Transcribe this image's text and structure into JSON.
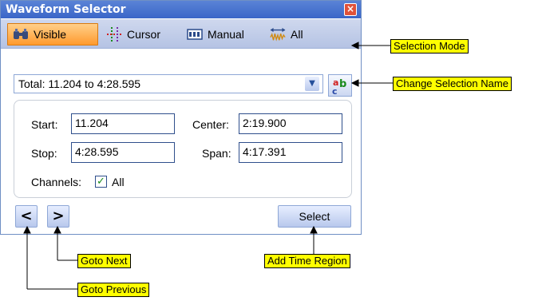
{
  "window": {
    "title": "Waveform Selector",
    "close_icon": "close-icon"
  },
  "modes": {
    "visible": "Visible",
    "cursor": "Cursor",
    "manual": "Manual",
    "all": "All"
  },
  "selection": {
    "name": "Total:  11.204 to 4:28.595"
  },
  "fields": {
    "start_label": "Start:",
    "start_value": "11.204",
    "center_label": "Center:",
    "center_value": "2:19.900",
    "stop_label": "Stop:",
    "stop_value": "4:28.595",
    "span_label": "Span:",
    "span_value": "4:17.391",
    "channels_label": "Channels:",
    "channels_all": "All"
  },
  "buttons": {
    "prev": "<",
    "next": ">",
    "select": "Select"
  },
  "callouts": {
    "selection_mode": "Selection Mode",
    "change_name": "Change Selection Name",
    "goto_next": "Goto Next",
    "goto_previous": "Goto Previous",
    "add_time_region": "Add Time Region"
  },
  "colors": {
    "accent": "#3a66c8",
    "active_mode": "#ff9a2e",
    "callout": "#ffff00"
  }
}
